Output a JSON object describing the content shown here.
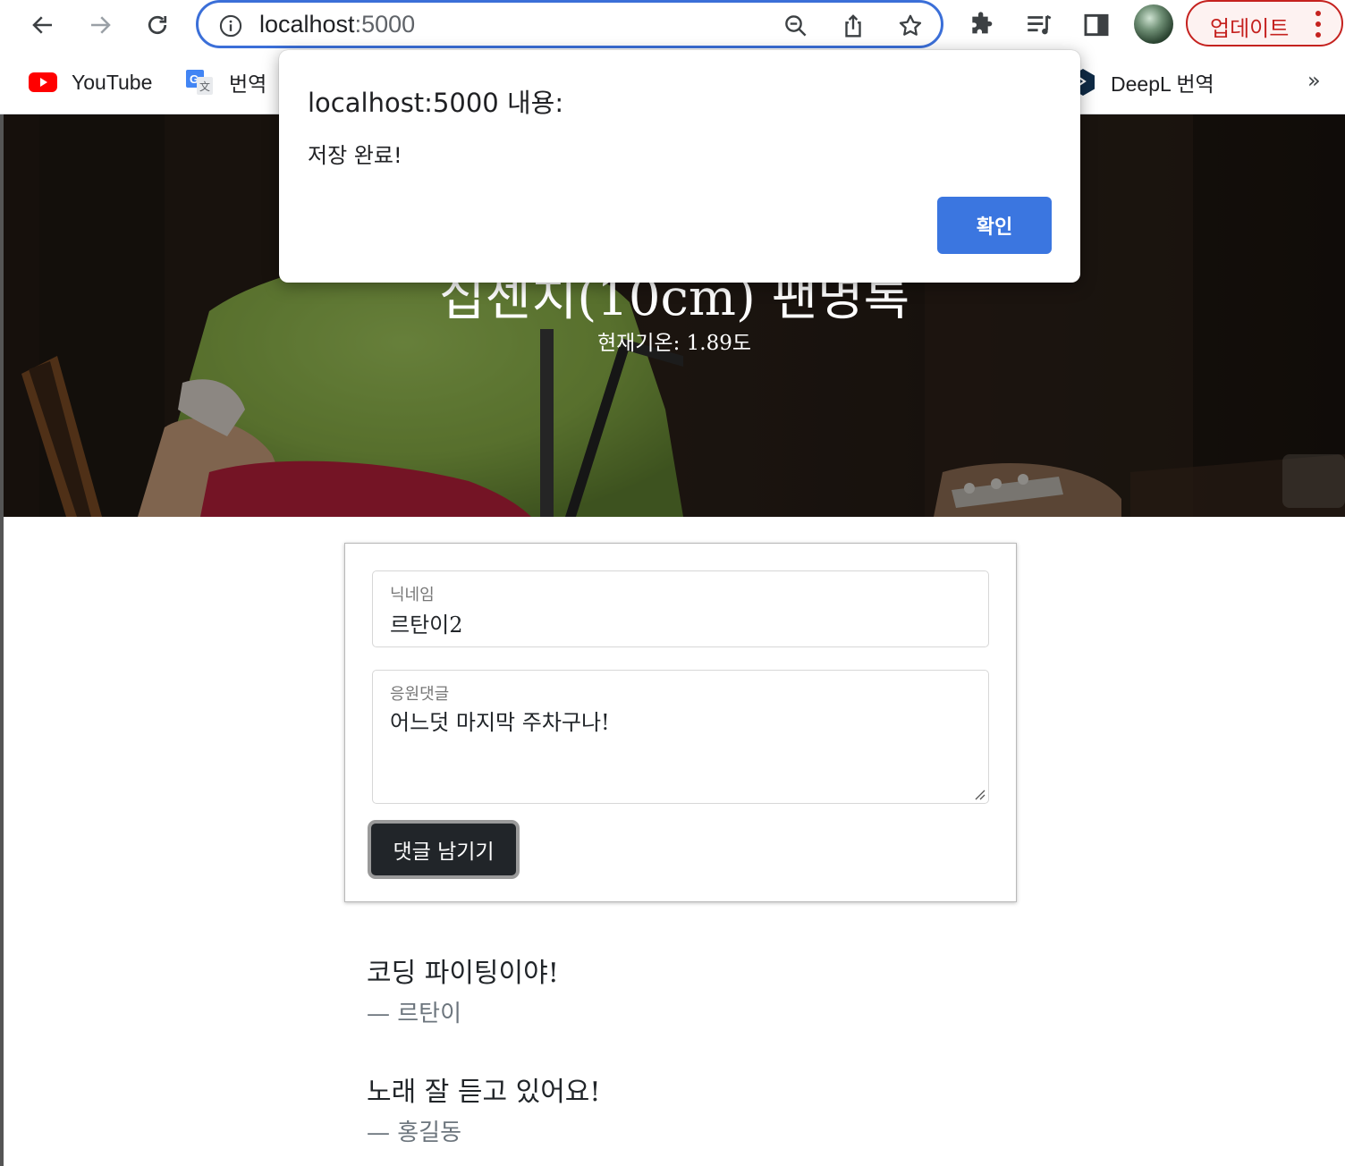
{
  "browser": {
    "url_host": "localhost",
    "url_port": ":5000",
    "update_label": "업데이트"
  },
  "bookmarks": [
    {
      "label": "YouTube",
      "icon": "youtube-icon"
    },
    {
      "label": "번역",
      "icon": "google-translate-icon"
    },
    {
      "label": "DeepL 번역",
      "icon": "deepl-icon"
    }
  ],
  "bookmarks_more": "»",
  "hero": {
    "title": "십센치(10cm) 팬명록",
    "weather": "현재기온: 1.89도"
  },
  "form": {
    "nickname_label": "닉네임",
    "nickname_value": "르탄이2",
    "comment_label": "응원댓글",
    "comment_value": "어느덧 마지막 주차구나!",
    "submit_label": "댓글 남기기"
  },
  "comments": [
    {
      "text": "코딩 파이팅이야!",
      "author": "— 르탄이"
    },
    {
      "text": "노래 잘 듣고 있어요!",
      "author": "— 홍길동"
    }
  ],
  "dialog": {
    "title": "localhost:5000 내용:",
    "message": "저장 완료!",
    "ok_label": "확인"
  },
  "colors": {
    "accent": "#3b76e0",
    "omnibox_border": "#3b6fd8",
    "update_red": "#c5221f",
    "button_dark": "#212529"
  }
}
